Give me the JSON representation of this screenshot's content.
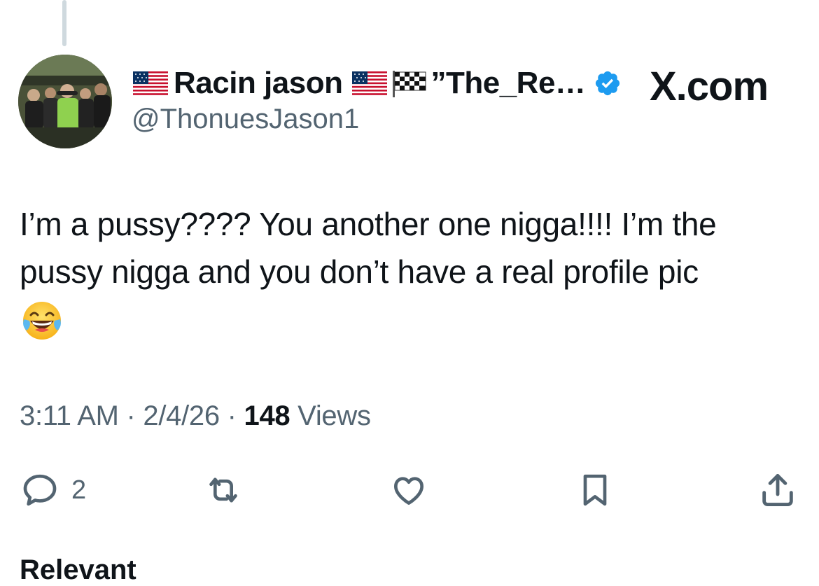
{
  "tweet": {
    "display_name_main": "Racin jason",
    "display_name_rest": "”The_Re…",
    "handle": "@ThonuesJason1",
    "text_lines": [
      "I’m a pussy???? You another one nigga!!!! I’m the",
      "pussy nigga and you don’t have a real profile pic"
    ],
    "emoji": "laughing-with-tears-emoji",
    "verified": true
  },
  "watermark": {
    "label": "X.com"
  },
  "meta": {
    "time": "3:11 AM",
    "separator": "·",
    "date": "2/4/26",
    "views_count": "148",
    "views_label": "Views"
  },
  "actions": {
    "reply_count": "2",
    "icons": [
      "reply-icon",
      "repost-icon",
      "like-icon",
      "bookmark-icon",
      "share-icon"
    ]
  },
  "section_label": "Relevant",
  "colors": {
    "text_primary": "#0f1419",
    "text_secondary": "#536471",
    "verified_blue": "#1d9bf0",
    "thread_line": "#cfd9de"
  }
}
